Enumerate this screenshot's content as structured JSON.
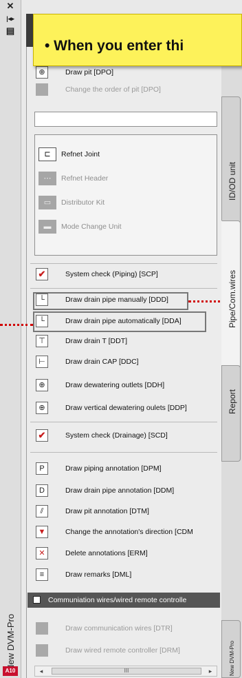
{
  "strip": {
    "close_glyph": "✕",
    "pin_glyph": "|◂▸",
    "props_glyph": "▤",
    "vertical_title": "New DVM-Pro",
    "logo_text": "A10"
  },
  "callout": {
    "text": "• When you enter thi"
  },
  "pit": {
    "draw_pit": "Draw pit [DPO]",
    "change_order": "Change the order of pit [DPO]"
  },
  "refnet": {
    "items": [
      {
        "label": "Refnet Joint",
        "disabled": false
      },
      {
        "label": "Refnet Header",
        "disabled": true
      },
      {
        "label": "Distributor Kit",
        "disabled": true
      },
      {
        "label": "Mode Change Unit",
        "disabled": true
      }
    ]
  },
  "commands": {
    "system_check_piping": "System check (Piping) [SCP]",
    "drain_manual": "Draw drain pipe manually [DDD]",
    "drain_auto": "Draw drain pipe automatically [DDA]",
    "drain_t": "Draw drain T [DDT]",
    "drain_cap": "Draw drain CAP [DDC]",
    "dewatering_outlets": "Draw dewatering outlets [DDH]",
    "vertical_dewatering": "Draw vertical dewatering oulets [DDP]",
    "system_check_drainage": "System check (Drainage) [SCD]",
    "piping_annotation": "Draw piping annotation [DPM]",
    "drain_annotation": "Draw drain pipe annotation [DDM]",
    "pit_annotation": "Draw pit annotation [DTM]",
    "change_annotation_direction": "Change the annotation's direction [CDM",
    "delete_annotations": "Delete annotations [ERM]",
    "draw_remarks": "Draw remarks [DML]"
  },
  "comm_section": {
    "header": "Communiation wires/wired remote controlle",
    "draw_comm_wires": "Draw communication wires [DTR]",
    "draw_wired_remote": "Draw wired remote controller [DRM]"
  },
  "tabs": {
    "idod": "ID/OD unit",
    "pipe": "Pipe/Com.wires",
    "report": "Report",
    "newdvm": "New DVM-Pro"
  },
  "scrollbar": {
    "left_arrow": "◂",
    "right_arrow": "▸",
    "thumb_grip": "III"
  },
  "icons": {
    "pit": "circle-cross-icon",
    "check": "red-check-icon",
    "drain": "drain-pipe-icon"
  },
  "colors": {
    "callout_bg": "#fdf25a",
    "highlight_dots": "#d10000"
  }
}
